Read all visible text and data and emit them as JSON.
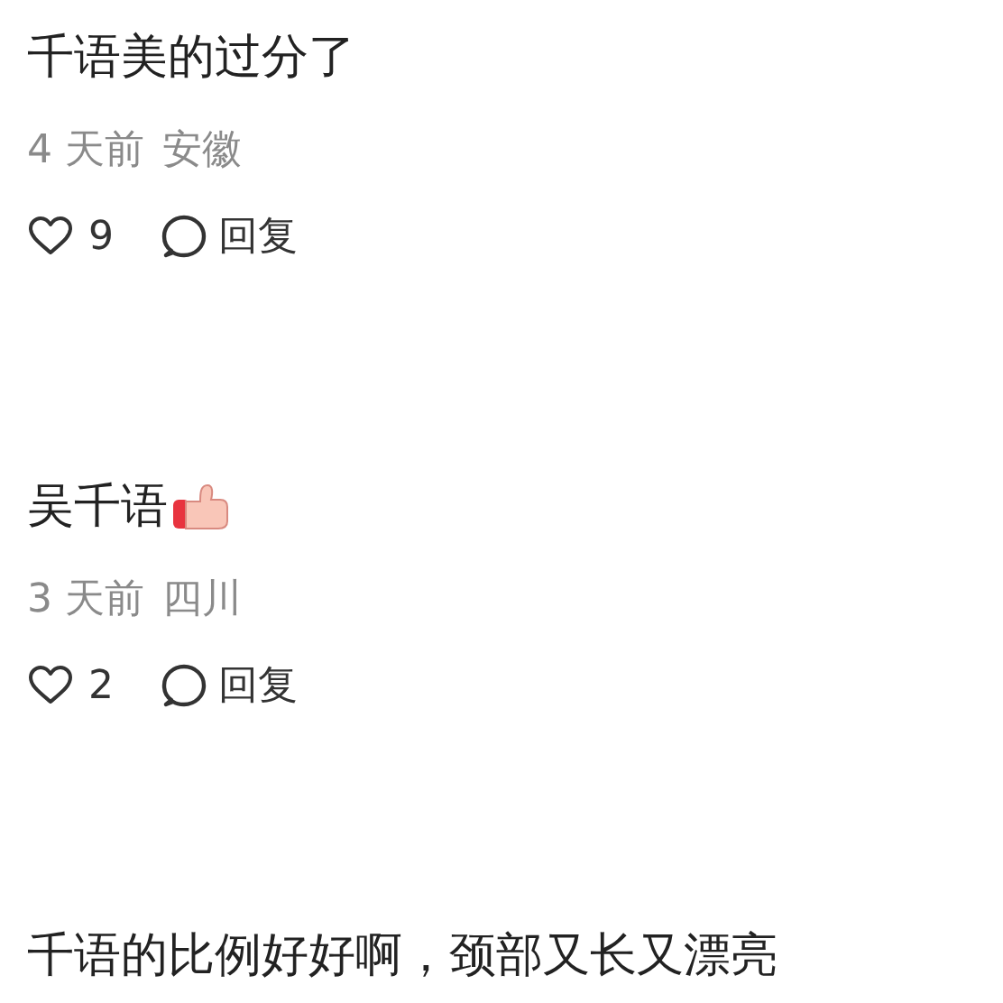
{
  "comments": [
    {
      "text": "千语美的过分了",
      "thumbs_up": false,
      "time": "4 天前",
      "location": "安徽",
      "likes": "9",
      "reply": "回复"
    },
    {
      "text": "吴千语",
      "thumbs_up": true,
      "time": "3 天前",
      "location": "四川",
      "likes": "2",
      "reply": "回复"
    },
    {
      "text": "千语的比例好好啊，颈部又长又漂亮",
      "thumbs_up": false
    }
  ]
}
